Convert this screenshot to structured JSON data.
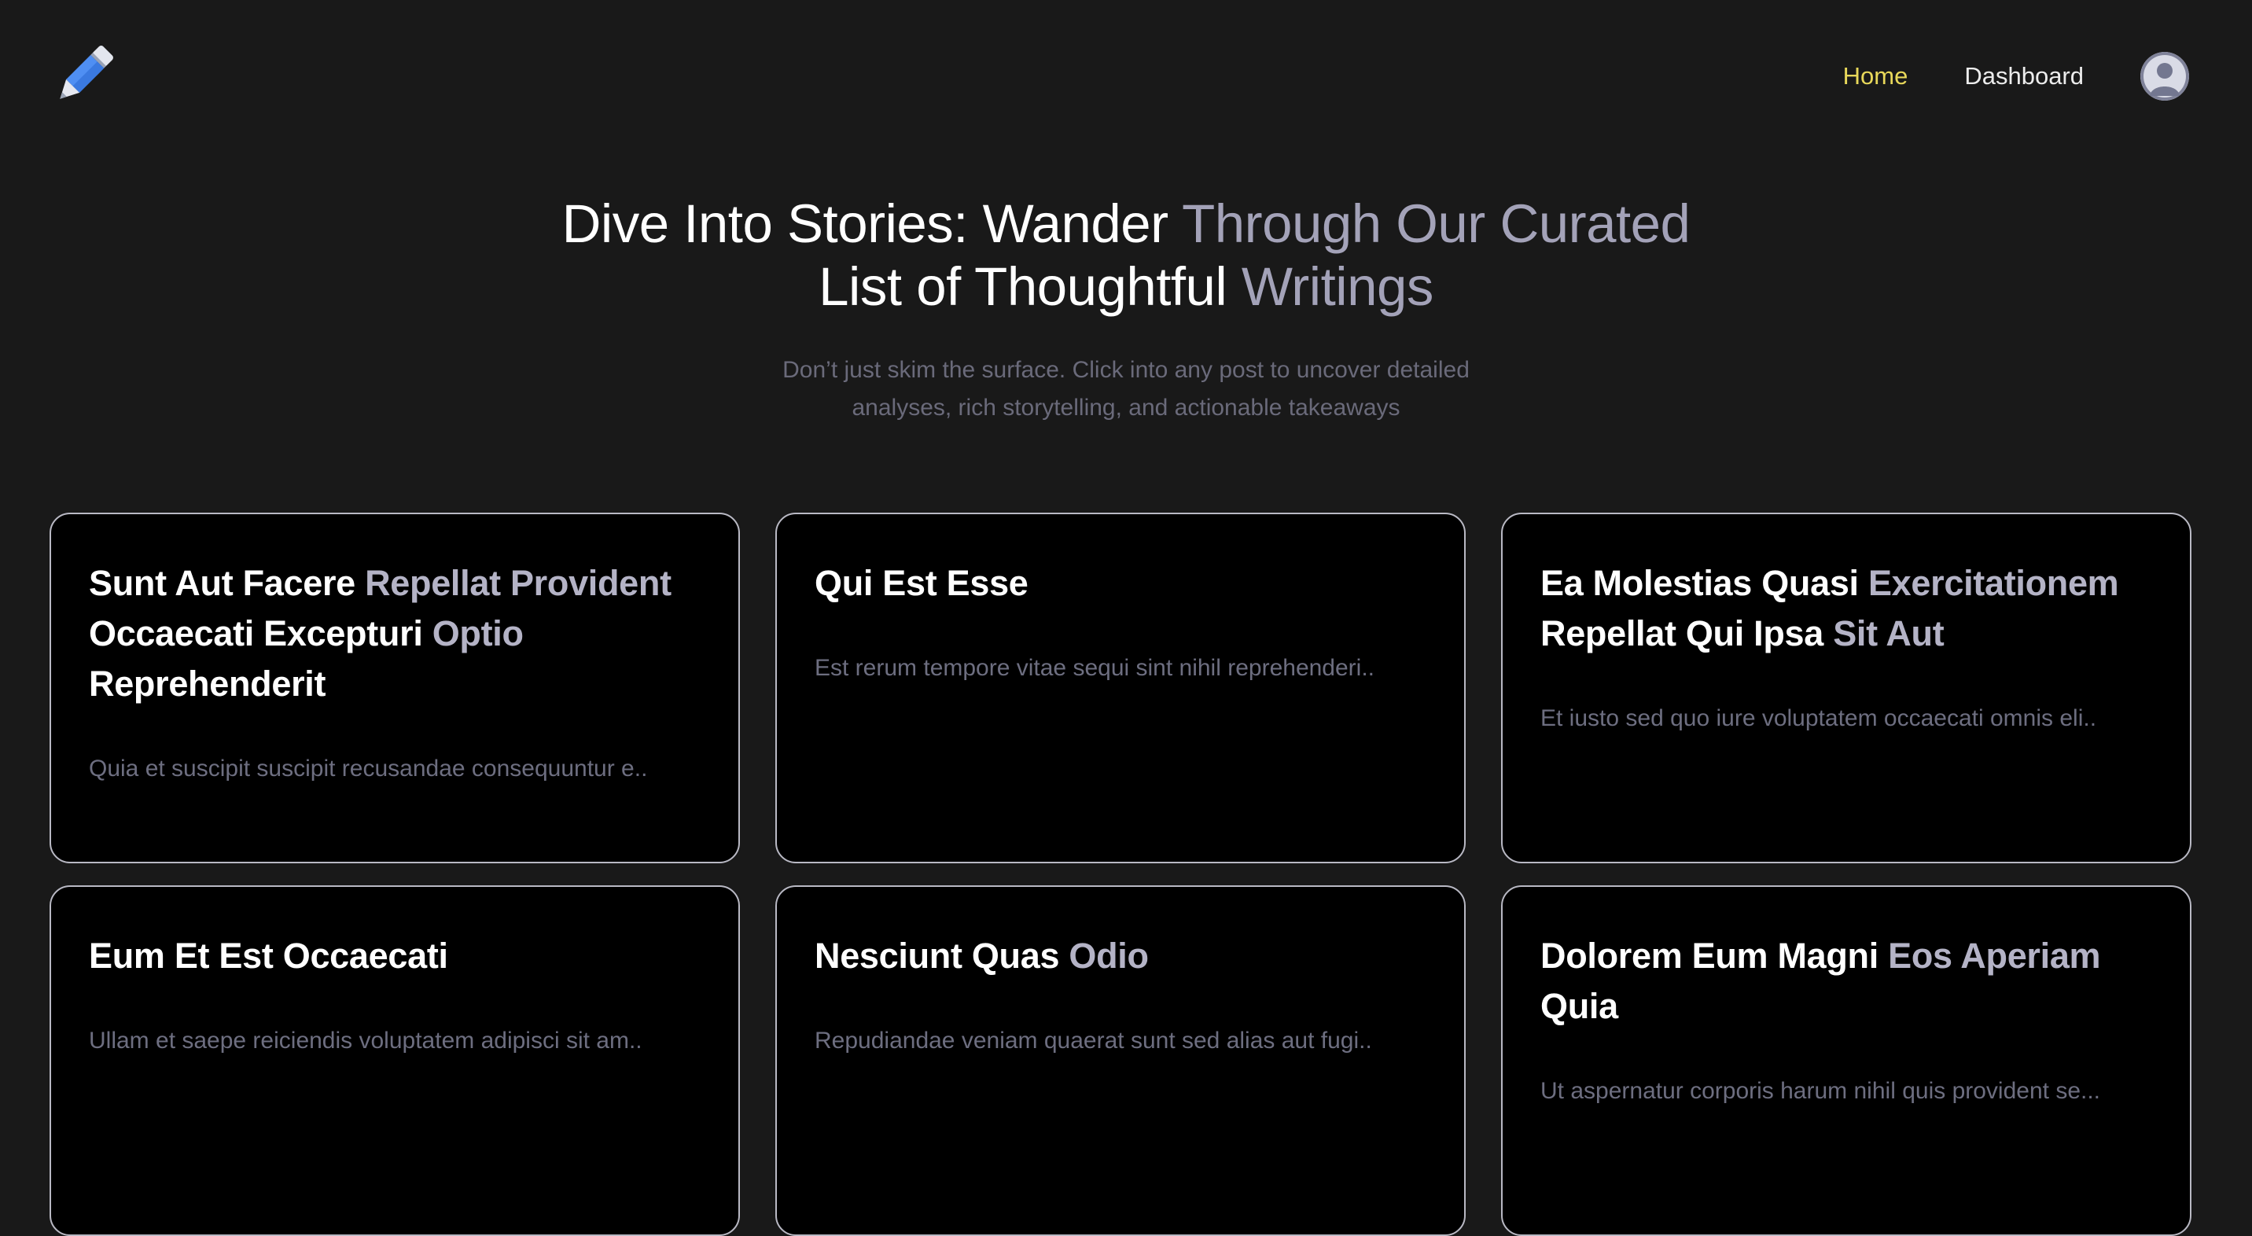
{
  "header": {
    "logo_icon": "pencil-icon",
    "nav": [
      {
        "label": "Home",
        "active": true
      },
      {
        "label": "Dashboard",
        "active": false
      }
    ],
    "avatar_icon": "user-avatar-icon"
  },
  "hero": {
    "title_parts": [
      {
        "text": "Dive Into Stories: Wander ",
        "tone": "white"
      },
      {
        "text": "Through Our Curated",
        "tone": "muted"
      },
      {
        "text": "List of Thoughtful ",
        "tone": "white"
      },
      {
        "text": "Writings",
        "tone": "muted"
      }
    ],
    "subtitle_line1": "Don’t just skim the surface. Click into any post to uncover detailed",
    "subtitle_line2": "analyses, rich storytelling, and actionable takeaways"
  },
  "posts": [
    {
      "title_parts": [
        {
          "text": "Sunt Aut Facere ",
          "tone": "white"
        },
        {
          "text": "Repellat Provident",
          "tone": "muted"
        },
        {
          "text": "Occaecati Excepturi ",
          "tone": "white"
        },
        {
          "text": "Optio",
          "tone": "muted"
        },
        {
          "text": "Reprehenderit",
          "tone": "white"
        }
      ],
      "excerpt": "Quia et suscipit suscipit recusandae consequuntur e.."
    },
    {
      "title_parts": [
        {
          "text": "Qui Est Esse",
          "tone": "white"
        }
      ],
      "excerpt": "Est rerum tempore vitae sequi sint nihil reprehenderi.."
    },
    {
      "title_parts": [
        {
          "text": "Ea Molestias Quasi ",
          "tone": "white"
        },
        {
          "text": "Exercitationem",
          "tone": "muted"
        },
        {
          "text": "Repellat Qui Ipsa ",
          "tone": "white"
        },
        {
          "text": "Sit Aut",
          "tone": "muted"
        }
      ],
      "excerpt": "Et iusto sed quo iure voluptatem occaecati omnis eli.."
    },
    {
      "title_parts": [
        {
          "text": "Eum Et Est Occaecati",
          "tone": "white"
        }
      ],
      "excerpt": "Ullam et saepe reiciendis voluptatem adipisci sit am.."
    },
    {
      "title_parts": [
        {
          "text": "Nesciunt Quas ",
          "tone": "white"
        },
        {
          "text": "Odio",
          "tone": "muted"
        }
      ],
      "excerpt": "Repudiandae veniam quaerat sunt sed alias aut fugi.."
    },
    {
      "title_parts": [
        {
          "text": "Dolorem Eum Magni ",
          "tone": "white"
        },
        {
          "text": "Eos Aperiam",
          "tone": "muted"
        },
        {
          "text": "Quia",
          "tone": "white"
        }
      ],
      "excerpt": "Ut aspernatur corporis harum nihil quis provident se..."
    }
  ]
}
